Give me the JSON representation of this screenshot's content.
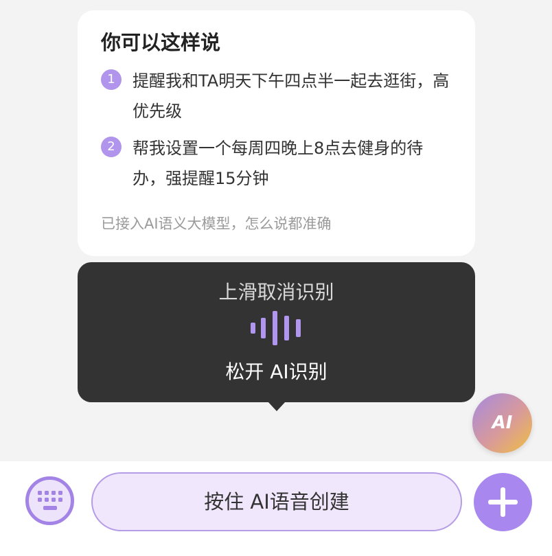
{
  "tips": {
    "title": "你可以这样说",
    "items": [
      {
        "number": "1",
        "text": "提醒我和TA明天下午四点半一起去逛街，高优先级"
      },
      {
        "number": "2",
        "text": "帮我设置一个每周四晚上8点去健身的待办，强提醒15分钟"
      }
    ],
    "footer": "已接入AI语义大模型，怎么说都准确"
  },
  "voice_panel": {
    "cancel_hint": "上滑取消识别",
    "release_hint": "松开 AI识别",
    "icon": "sound-wave-icon"
  },
  "ai_button": {
    "label": "AI"
  },
  "bottom_bar": {
    "keyboard_icon": "keyboard-icon",
    "voice_button_label": "按住 AI语音创建",
    "add_icon": "plus-icon"
  },
  "colors": {
    "accent": "#a887ee",
    "panel": "#333333",
    "wave": "#b196f0"
  }
}
